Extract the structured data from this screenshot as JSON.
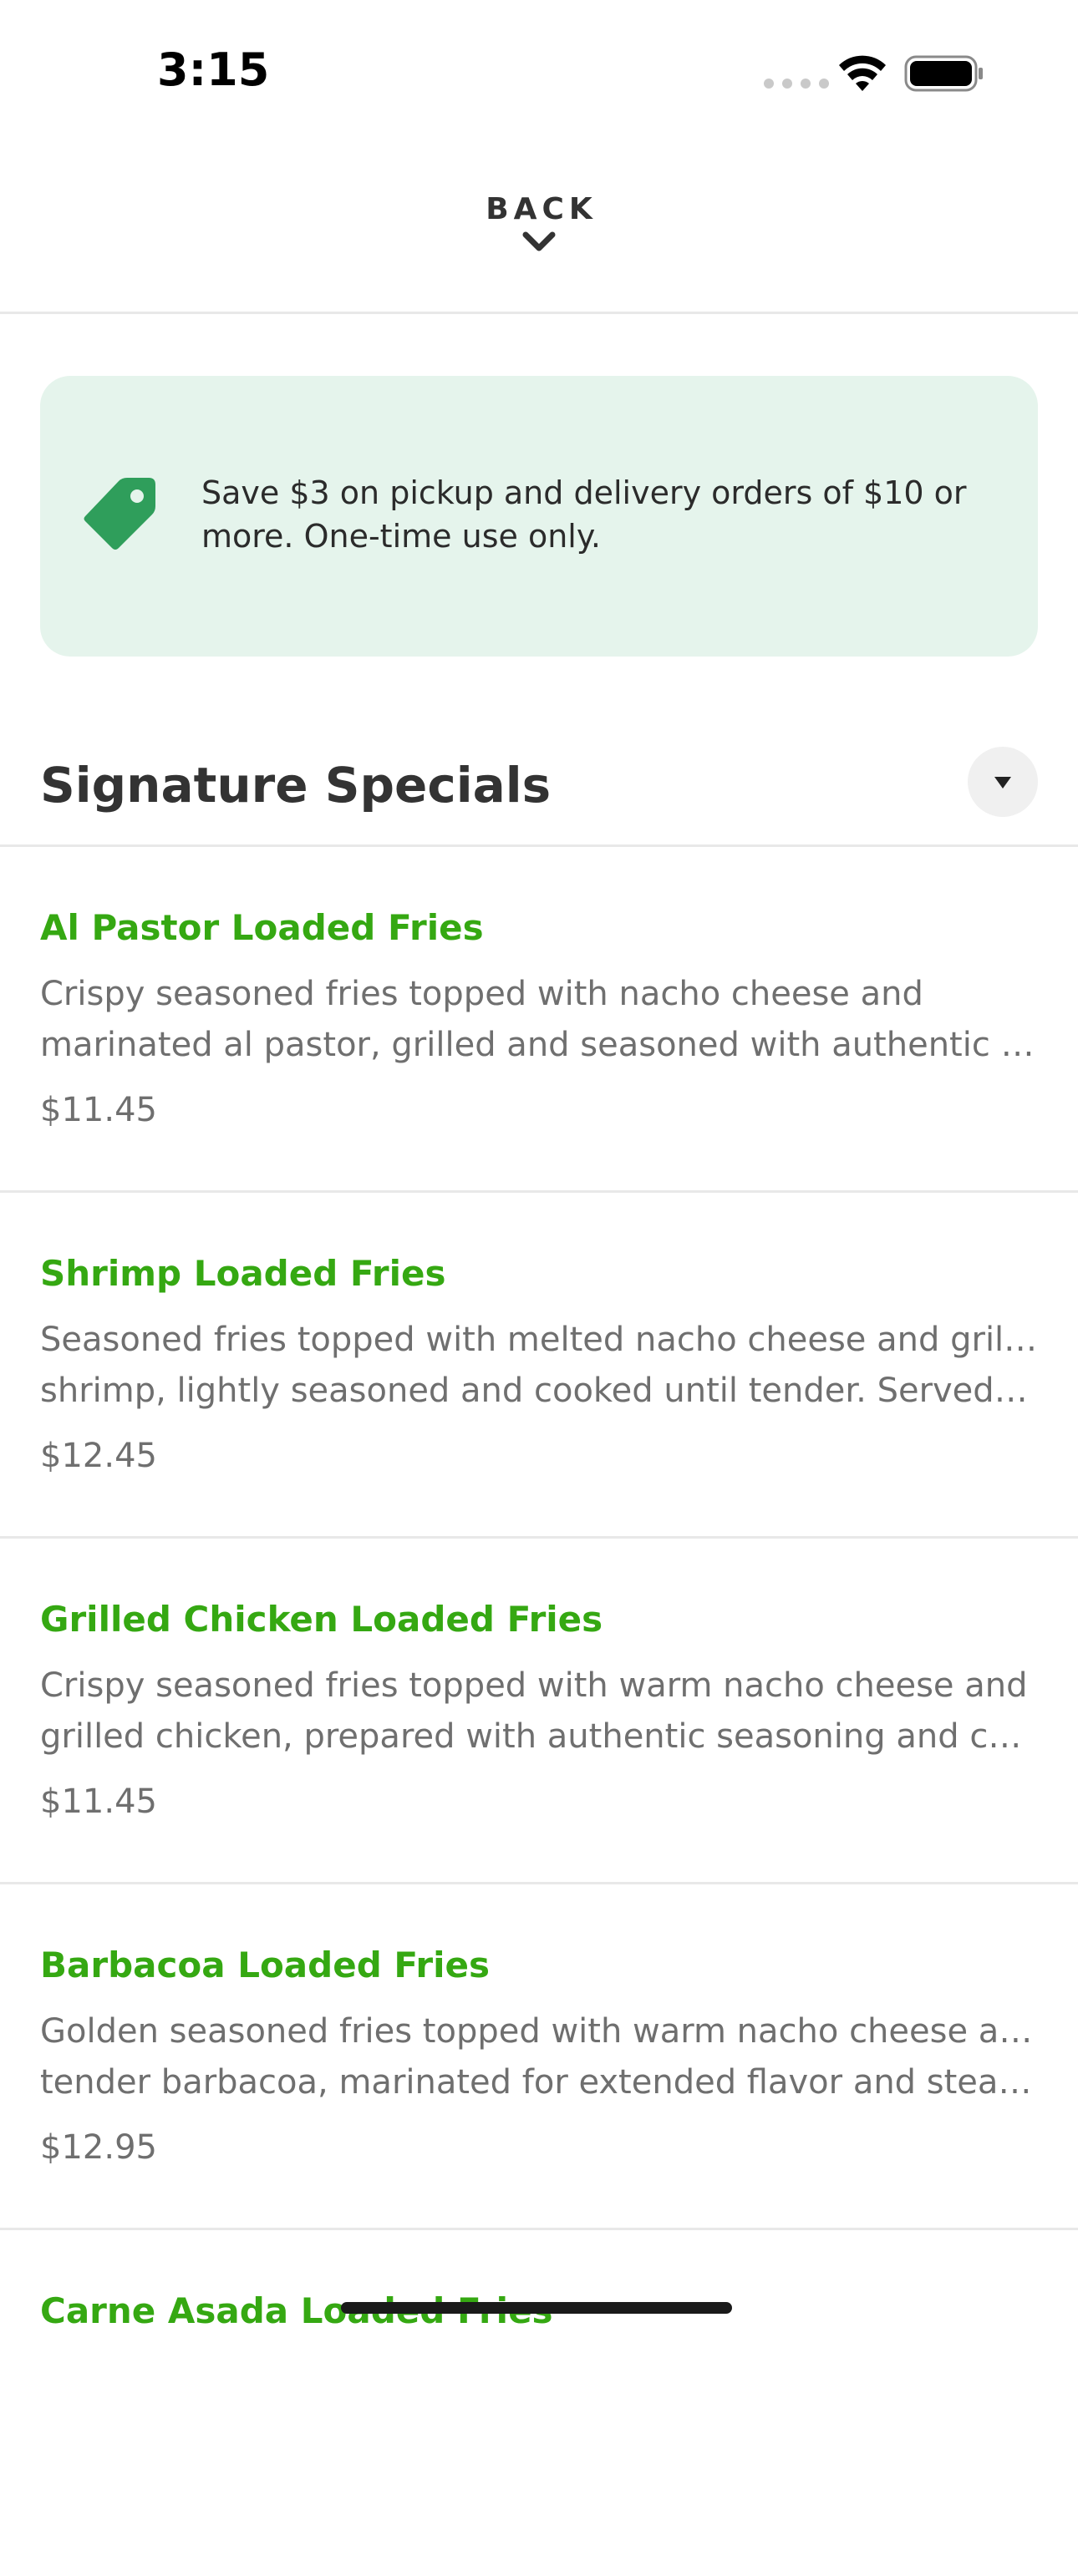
{
  "status_bar": {
    "time": "3:15"
  },
  "header": {
    "back_label": "BACK"
  },
  "promo": {
    "text": "Save $3 on pickup and delivery orders of $10 or more. One-time use only.",
    "icon": "tag-icon",
    "background_color": "#e5f4ec",
    "icon_color": "#2f9e5b"
  },
  "section": {
    "title": "Signature Specials"
  },
  "colors": {
    "accent": "#35a812",
    "text_secondary": "#6f6f6f"
  },
  "menu_items": [
    {
      "name": "Al Pastor Loaded Fries",
      "desc_line1": "Crispy seasoned fries topped with nacho cheese and",
      "desc_line2": "marinated al pastor, grilled and seasoned with authentic sp...",
      "price": "$11.45"
    },
    {
      "name": "Shrimp Loaded Fries",
      "desc_line1": "Seasoned fries topped with melted nacho cheese and grilled",
      "desc_line2": "shrimp, lightly seasoned and cooked until tender. Served w...",
      "price": "$12.45"
    },
    {
      "name": "Grilled Chicken Loaded Fries",
      "desc_line1": "Crispy seasoned fries topped with warm nacho cheese and",
      "desc_line2": "grilled chicken, prepared with authentic seasoning and coo...",
      "price": "$11.45"
    },
    {
      "name": "Barbacoa Loaded Fries",
      "desc_line1": "Golden seasoned fries topped with warm nacho cheese and",
      "desc_line2": "tender barbacoa, marinated for extended flavor and steam...",
      "price": "$12.95"
    },
    {
      "name": "Carne Asada Loaded Fries"
    }
  ]
}
